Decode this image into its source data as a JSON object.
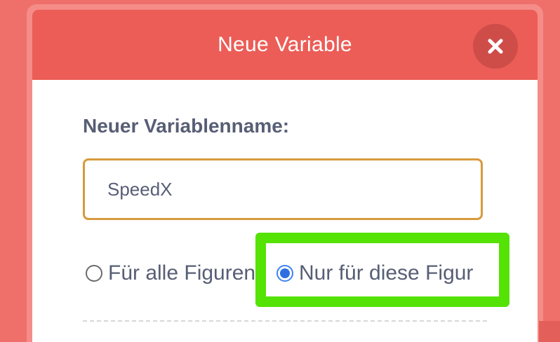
{
  "modal": {
    "title": "Neue Variable",
    "close_icon": "close-icon"
  },
  "form": {
    "name_label": "Neuer Variablenname:",
    "name_value": "SpeedX",
    "scope_options": [
      {
        "label": "Für alle Figuren",
        "selected": false
      },
      {
        "label": "Nur für diese Figur",
        "selected": true
      }
    ]
  },
  "colors": {
    "backdrop": "#ef6f6a",
    "header": "#ec5d57",
    "close_button": "#cf4d49",
    "input_border": "#d89a3c",
    "highlight": "#55e205",
    "radio_selected": "#2f6ee0",
    "text": "#575e75"
  }
}
